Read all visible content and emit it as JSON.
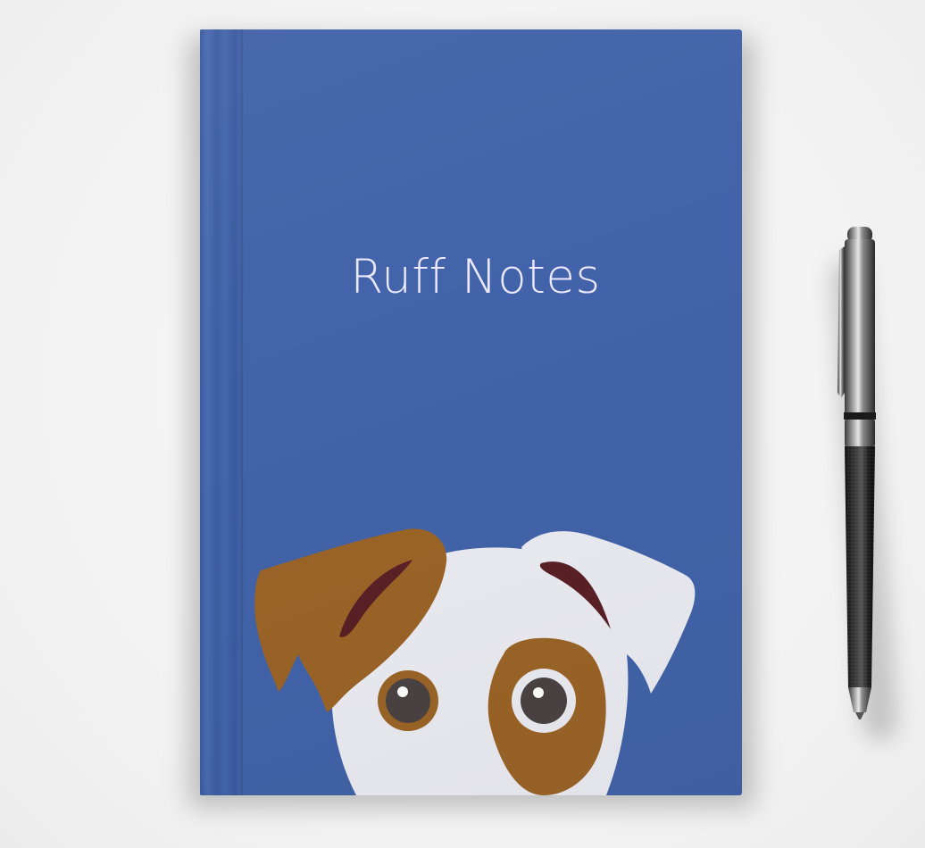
{
  "notebook": {
    "title": "Ruff Notes",
    "cover_color": "#4263a9",
    "title_color": "#ece8ff"
  },
  "illustration": {
    "subject": "dog-face-icon",
    "ear_color": "#9b6427",
    "face_color": "#ebebf2",
    "inner_ear_color": "#5a2026",
    "eye_color": "#4b4343"
  },
  "props": {
    "pen": "pen-icon"
  }
}
